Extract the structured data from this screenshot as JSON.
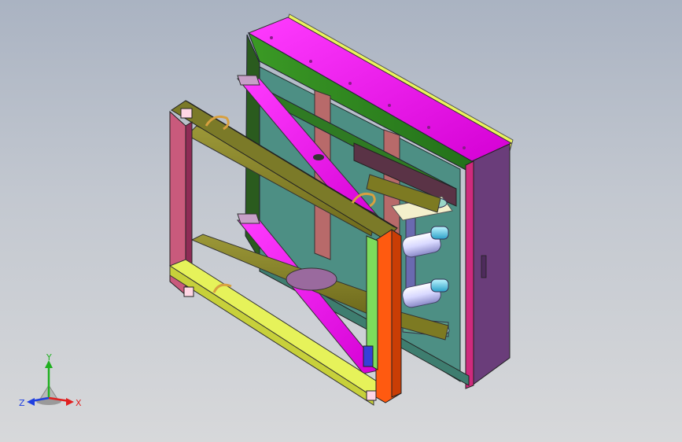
{
  "viewport": {
    "colors": {
      "background_top": "#aab3c2",
      "background_bottom": "#d7d8da",
      "frame_magenta": "#ff1aff",
      "frame_green": "#2e8b1c",
      "frame_teal": "#4a8f80",
      "arm_olive": "#8f8a2a",
      "rail_yellow": "#e6f25a",
      "post_orange": "#ff5a10",
      "post_purple": "#6a3d7a",
      "cylinder": "#ffffff"
    }
  },
  "triad": {
    "x_label": "X",
    "y_label": "Y",
    "z_label": "Z",
    "x_color": "#e02020",
    "y_color": "#20b020",
    "z_color": "#2040e0"
  }
}
